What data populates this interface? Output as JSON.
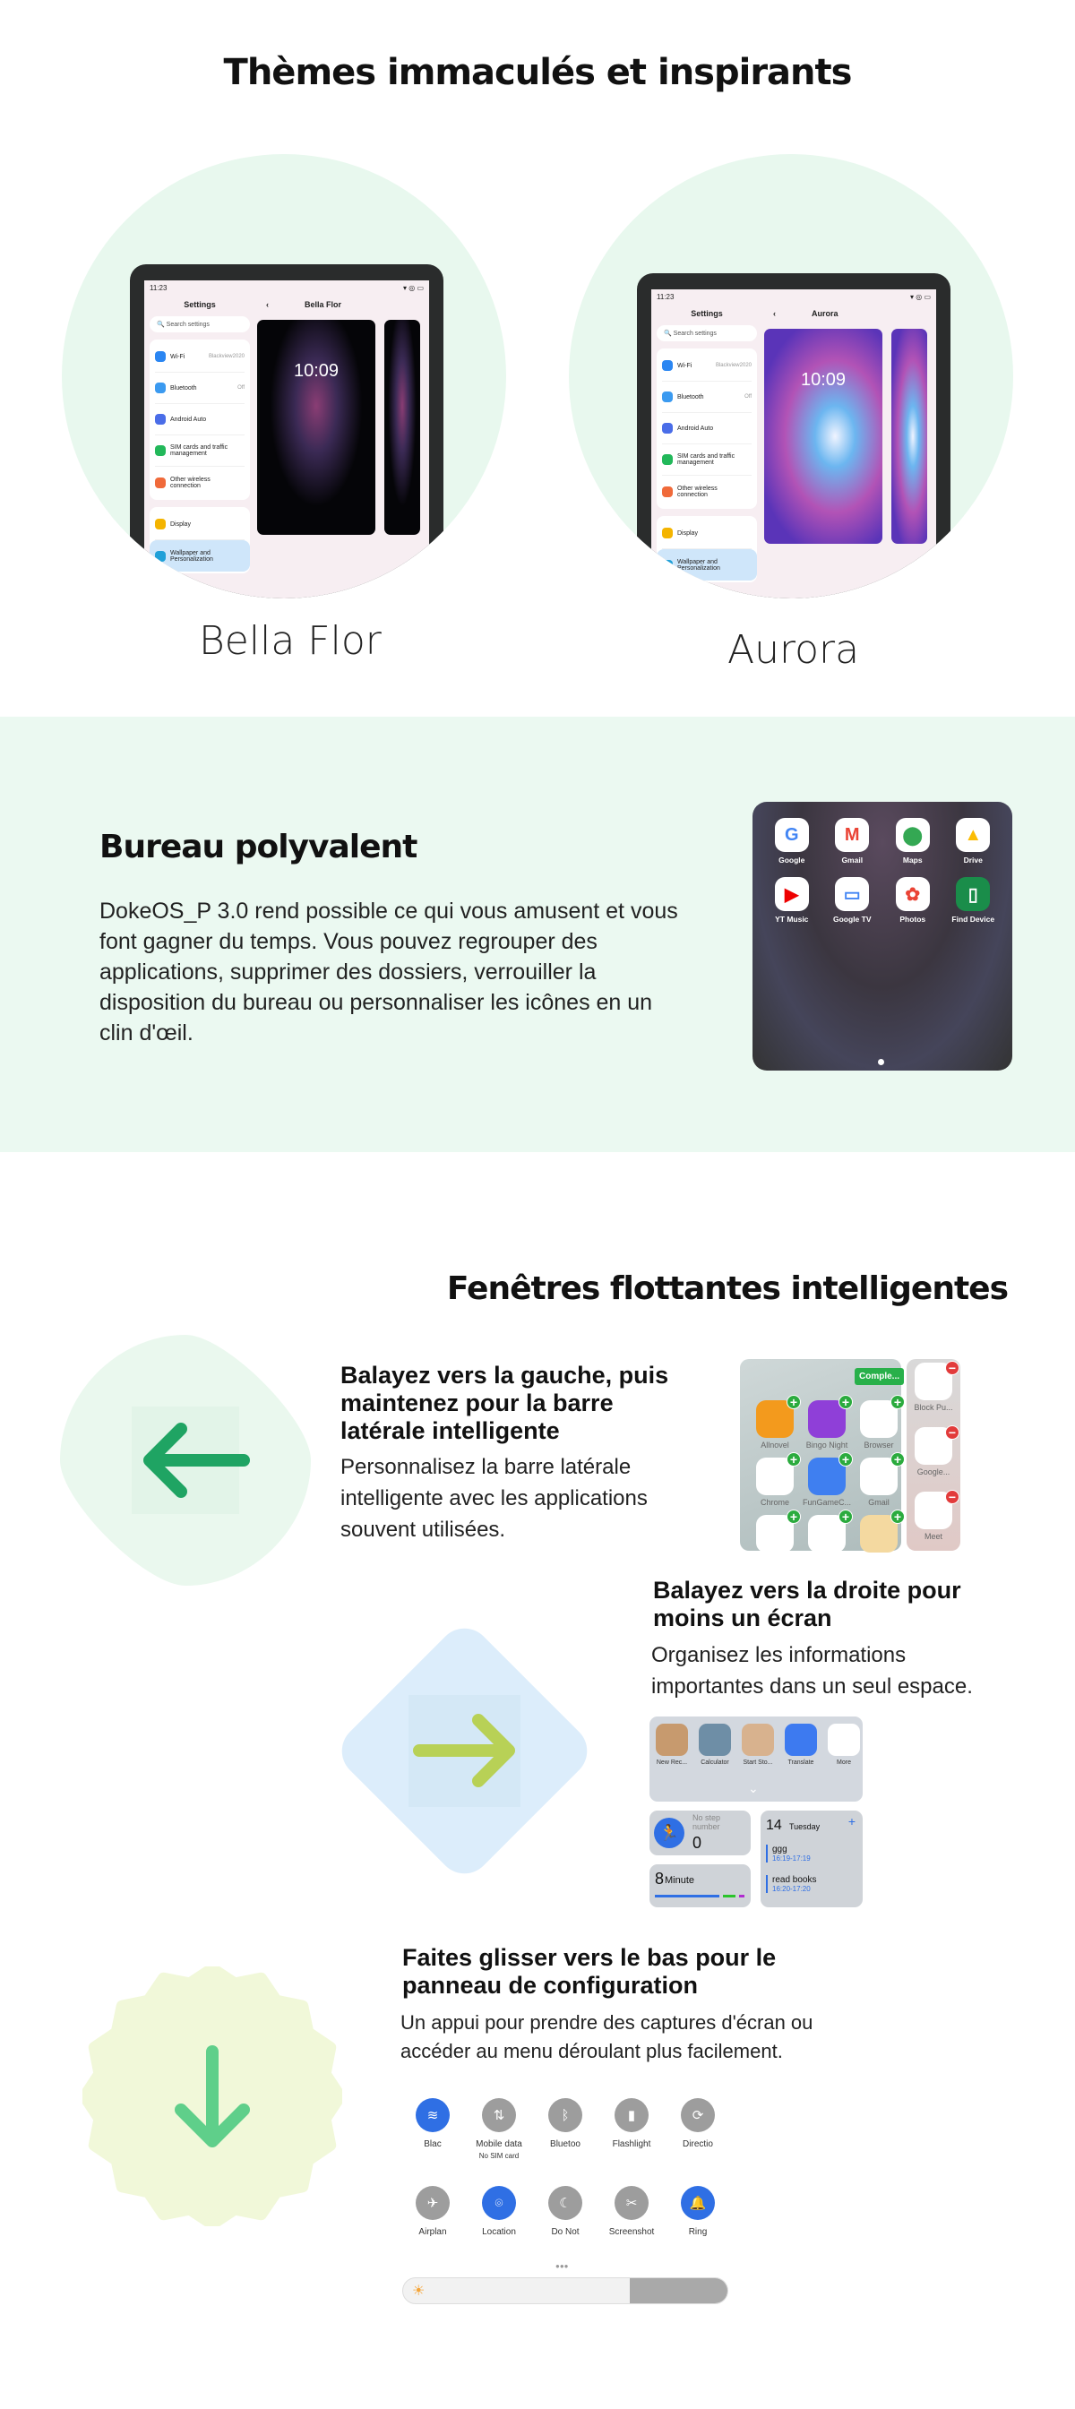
{
  "title": "Thèmes immaculés et inspirants",
  "themes": [
    {
      "name": "Bella Flor",
      "detail_title": "Bella Flor",
      "time": "10:09"
    },
    {
      "name": "Aurora",
      "detail_title": "Aurora",
      "time": "10:09"
    }
  ],
  "settings": {
    "status_time": "11:23",
    "status_icons": "wifi-icon battery-icon",
    "header": "Settings",
    "search_placeholder": "Search settings",
    "items": [
      {
        "label": "Wi-Fi",
        "value": "Blackview2020",
        "color": "#2b86f2"
      },
      {
        "label": "Bluetooth",
        "value": "Off",
        "color": "#3b9af0"
      },
      {
        "label": "Android Auto",
        "value": "",
        "color": "#4a6de8"
      },
      {
        "label": "SIM cards and traffic management",
        "value": "",
        "color": "#22b85a"
      },
      {
        "label": "Other wireless connection",
        "value": "",
        "color": "#f06a3a"
      },
      {
        "label": "Display",
        "value": "",
        "color": "#f4b400"
      },
      {
        "label": "Wallpaper and Personalization",
        "value": "",
        "color": "#1fa0d8"
      }
    ]
  },
  "desktop": {
    "heading": "Bureau polyvalent",
    "text": "DokeOS_P 3.0 rend possible ce qui vous amusent et vous font gagner du temps. Vous pouvez regrouper des applications, supprimer des dossiers, verrouiller la disposition du bureau ou personnaliser les icônes en un clin d'œil.",
    "apps": [
      "Google",
      "Gmail",
      "Maps",
      "Drive",
      "YT Music",
      "Google TV",
      "Photos",
      "Find Device"
    ]
  },
  "floating": {
    "heading": "Fenêtres flottantes intelligentes",
    "items": [
      {
        "heading": "Balayez vers la gauche, puis maintenez pour la barre latérale intelligente",
        "text": "Personnalisez la barre latérale intelligente avec les applications souvent utilisées.",
        "icon": "arrow-left-icon",
        "color": "#1fa463"
      },
      {
        "heading": "Balayez vers la droite pour moins un écran",
        "text": "Organisez les informations importantes dans un seul espace.",
        "icon": "arrow-right-icon",
        "color": "#b8d156"
      },
      {
        "heading": "Faites glisser vers le bas pour le panneau de configuration",
        "text": "Un appui pour prendre des captures d'écran ou accéder au menu déroulant plus facilement.",
        "icon": "arrow-down-icon",
        "color": "#5fcf8a"
      }
    ]
  },
  "sidebar": {
    "complete_label": "Comple...",
    "apps": [
      "Allnovel",
      "Bingo Night",
      "Browser",
      "Chrome",
      "FunGameC...",
      "Gmail",
      "",
      "",
      ""
    ],
    "pinned": [
      "Block Pu...",
      "Google...",
      "Meet"
    ]
  },
  "minus_screen": {
    "shortcuts": [
      "New Rec...",
      "Calculator",
      "Start Sto...",
      "Translate",
      "More"
    ],
    "steps_label": "No step number",
    "steps_value": "0",
    "minutes_value": "8",
    "minutes_unit": "Minute",
    "date_day": "14",
    "date_weekday": "Tuesday",
    "events": [
      {
        "title": "ggg",
        "time": "16:19-17:19"
      },
      {
        "title": "read books",
        "time": "16:20-17:20"
      }
    ]
  },
  "quick_settings": {
    "tiles": [
      {
        "label": "Blac",
        "sub": "",
        "on": true,
        "glyph": "wifi-icon"
      },
      {
        "label": "Mobile data",
        "sub": "No SIM card",
        "on": false,
        "glyph": "data-icon"
      },
      {
        "label": "Bluetoo",
        "sub": "",
        "on": false,
        "glyph": "bluetooth-icon"
      },
      {
        "label": "Flashlight",
        "sub": "",
        "on": false,
        "glyph": "flashlight-icon"
      },
      {
        "label": "Directio",
        "sub": "",
        "on": false,
        "glyph": "rotation-icon"
      },
      {
        "label": "Airplan",
        "sub": "",
        "on": false,
        "glyph": "airplane-icon"
      },
      {
        "label": "Location",
        "sub": "",
        "on": true,
        "glyph": "location-icon"
      },
      {
        "label": "Do Not",
        "sub": "",
        "on": false,
        "glyph": "moon-icon"
      },
      {
        "label": "Screenshot",
        "sub": "",
        "on": false,
        "glyph": "screenshot-icon"
      },
      {
        "label": "Ring",
        "sub": "",
        "on": true,
        "glyph": "bell-icon"
      }
    ],
    "brightness": 0.7
  }
}
